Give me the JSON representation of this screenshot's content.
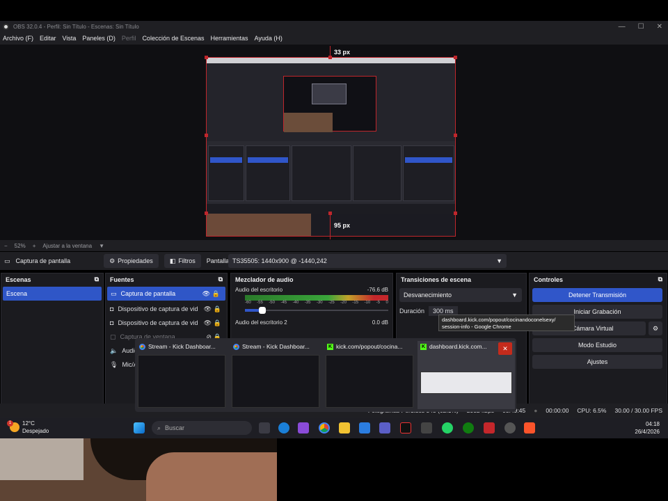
{
  "window": {
    "title": "OBS 32.0.4 - Perfil: Sin Título - Escenas: Sin Título",
    "controls": [
      "—",
      "☐",
      "✕"
    ]
  },
  "menu": [
    "Archivo (F)",
    "Editar",
    "Vista",
    "Paneles (D)",
    "Perfil",
    "Colección de Escenas",
    "Herramientas",
    "Ayuda (H)"
  ],
  "preview": {
    "top_gap_label": "33 px",
    "bottom_gap_label": "95 px"
  },
  "zoom": {
    "minus": "−",
    "value": "52%",
    "plus": "+",
    "fit_label": "Ajustar a la ventana"
  },
  "source_bar": {
    "selected_source": "Captura de pantalla",
    "properties_label": "Propiedades",
    "filters_label": "Filtros",
    "display_label": "Pantalla",
    "display_value": "TS35505: 1440x900 @ -1440,242"
  },
  "docks": {
    "scenes": {
      "title": "Escenas",
      "items": [
        "Escena"
      ]
    },
    "sources": {
      "title": "Fuentes",
      "items": [
        "Captura de pantalla",
        "Dispositivo de captura de vid",
        "Dispositivo de captura de vid",
        "Captura de ventana",
        "Audio",
        "Mic/A"
      ]
    },
    "mixer": {
      "title": "Mezclador de audio",
      "tracks": [
        {
          "name": "Audio del escritorio",
          "db": "-76.6 dB"
        },
        {
          "name": "Audio del escritorio 2",
          "db": "0.0 dB"
        }
      ],
      "ticks": [
        "-60",
        "-55",
        "-50",
        "-45",
        "-40",
        "-35",
        "-30",
        "-25",
        "-20",
        "-15",
        "-10",
        "-5",
        "0"
      ],
      "volume_level": 0.12
    },
    "transitions": {
      "title": "Transiciones de escena",
      "selected": "Desvanecimiento",
      "duration_label": "Duración",
      "duration_value": "300 ms"
    },
    "controls": {
      "title": "Controles",
      "buttons": [
        "Detener Transmisión",
        "Iniciar Grabación",
        "Iniciar Cámara Virtual",
        "Modo Estudio",
        "Ajustes"
      ],
      "virtual_cam_visible": "ar Cámara Virtual"
    }
  },
  "status": {
    "dropped": "Fotogramas Perdidos 345 (62.1%)",
    "bitrate": "2932 kbps",
    "stream_time": "03:49:45",
    "rec_time": "00:00:00",
    "cpu": "CPU: 6.5%",
    "fps": "30.00 / 30.00 FPS"
  },
  "taskbar": {
    "weather_temp": "12°C",
    "weather_desc": "Despejado",
    "weather_badge": "1",
    "search_placeholder": "Buscar",
    "time": "04:18",
    "date": "26/4/2026"
  },
  "thumbnails": [
    {
      "title": "Stream - Kick Dashboar...",
      "icon": "chrome"
    },
    {
      "title": "Stream - Kick Dashboar...",
      "icon": "chrome"
    },
    {
      "title": "kick.com/popout/cocina...",
      "icon": "kick"
    },
    {
      "title": "dashboard.kick.com...",
      "icon": "kick"
    }
  ],
  "tooltip": {
    "line1": "dashboard.kick.com/popout/cocinandoconelsexy/",
    "line2": "session-info - Google Chrome"
  },
  "colors": {
    "accent": "#3056c9",
    "selection_red": "#c0262c",
    "bg": "#1b1b1f"
  }
}
